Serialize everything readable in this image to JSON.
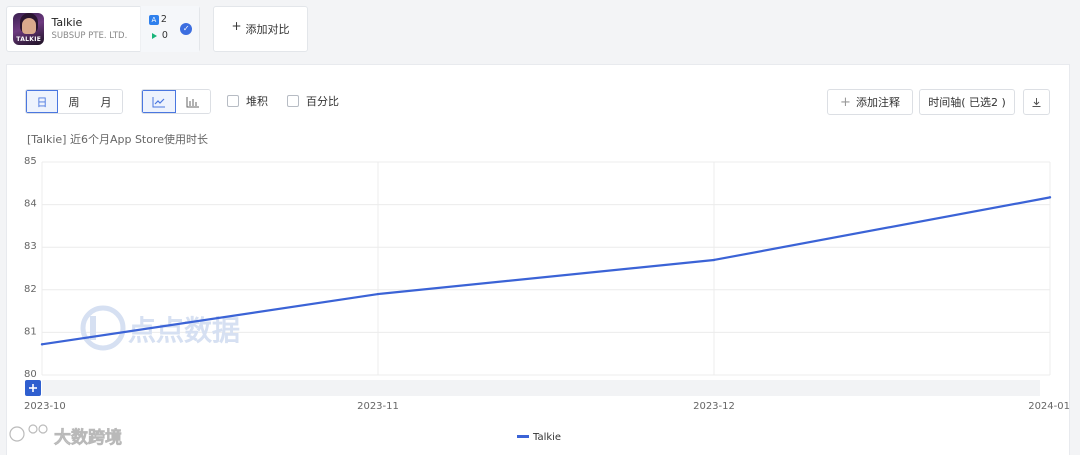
{
  "app": {
    "name": "Talkie",
    "developer": "SUBSUP PTE. LTD.",
    "icon_label": "TALKIE",
    "appstore_count": "2",
    "googleplay_count": "0",
    "selected": true
  },
  "compare_button": "添加对比",
  "toolbar": {
    "period_tabs": [
      "日",
      "周",
      "月"
    ],
    "active_period": "日",
    "chart_types": [
      "line-chart-icon",
      "bar-chart-icon"
    ],
    "active_chart_type": "line-chart-icon",
    "stack_label": "堆积",
    "percent_label": "百分比",
    "add_note_label": "添加注释",
    "timeline_label": "时间轴( 已选2 )"
  },
  "watermarks": {
    "center": "点点数据",
    "corner": "大数跨境"
  },
  "colors": {
    "series": "#3b63d6",
    "accent": "#3c6ee0"
  },
  "chart_data": {
    "type": "line",
    "title": "[Talkie]  近6个月App Store使用时长",
    "x": [
      "2023-10",
      "2023-11",
      "2023-12",
      "2024-01"
    ],
    "ylim": [
      80,
      85
    ],
    "yticks": [
      80,
      81,
      82,
      83,
      84,
      85
    ],
    "grid": true,
    "legend_position": "bottom-center",
    "series": [
      {
        "name": "Talkie",
        "values": [
          80.72,
          81.9,
          82.7,
          84.17
        ]
      }
    ]
  }
}
